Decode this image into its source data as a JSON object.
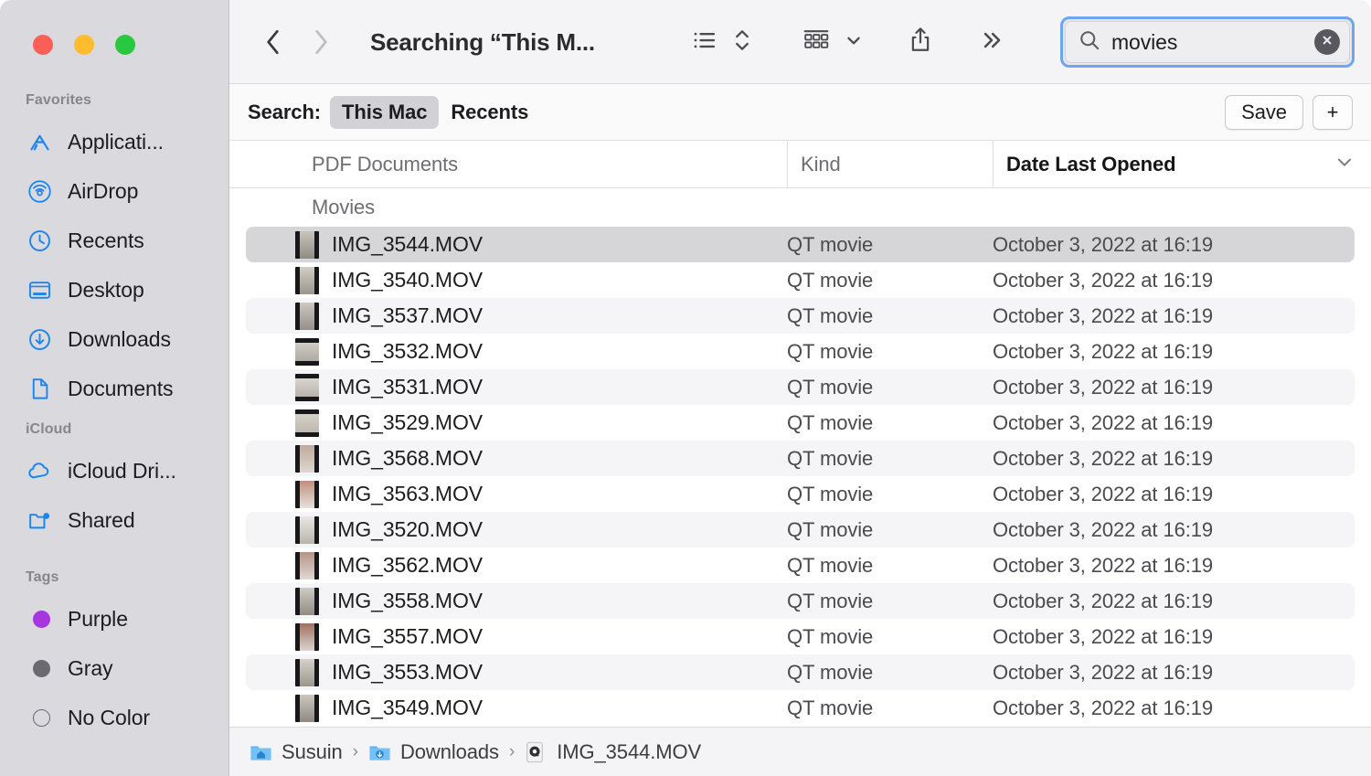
{
  "window": {
    "title": "Searching “This M...",
    "traffic_lights": [
      {
        "name": "close",
        "color": "#FC5F57"
      },
      {
        "name": "minimize",
        "color": "#FDBC2E"
      },
      {
        "name": "zoom",
        "color": "#28C840"
      }
    ]
  },
  "toolbar": {
    "back_icon": "chevron-left-icon",
    "forward_icon": "chevron-right-icon",
    "list_view_icon": "list-view-icon",
    "sort_icon": "sort-updown-icon",
    "group_icon": "group-by-icon",
    "group_chevron_icon": "chevron-down-icon",
    "share_icon": "share-icon",
    "more_icon": "double-chevron-right-icon"
  },
  "search": {
    "value": "movies",
    "placeholder": "Search",
    "search_icon": "search-icon",
    "clear_icon": "clear-circle-icon",
    "focus_color": "#6CA6F3"
  },
  "scopebar": {
    "label": "Search:",
    "scopes": [
      {
        "label": "This Mac",
        "selected": true
      },
      {
        "label": "Recents",
        "selected": false
      }
    ],
    "save_label": "Save",
    "add_label": "+"
  },
  "sidebar": {
    "sections": [
      {
        "title": "Favorites",
        "items": [
          {
            "label": "Applicati...",
            "icon": "applications-icon"
          },
          {
            "label": "AirDrop",
            "icon": "airdrop-icon"
          },
          {
            "label": "Recents",
            "icon": "clock-icon"
          },
          {
            "label": "Desktop",
            "icon": "desktop-icon"
          },
          {
            "label": "Downloads",
            "icon": "download-circle-icon"
          },
          {
            "label": "Documents",
            "icon": "document-icon"
          }
        ]
      },
      {
        "title": "iCloud",
        "items": [
          {
            "label": "iCloud Dri...",
            "icon": "cloud-icon"
          },
          {
            "label": "Shared",
            "icon": "shared-folder-icon"
          }
        ]
      },
      {
        "title": "Tags",
        "items": [
          {
            "label": "Purple",
            "icon": "tag-dot-icon",
            "color": "#A736DE"
          },
          {
            "label": "Gray",
            "icon": "tag-dot-icon",
            "color": "#6A6A70"
          },
          {
            "label": "No Color",
            "icon": "tag-dot-outline-icon",
            "color": "transparent"
          }
        ]
      }
    ]
  },
  "columns": {
    "name": "PDF Documents",
    "kind": "Kind",
    "date": "Date Last Opened",
    "sort_chevron_icon": "chevron-down-icon"
  },
  "filelist": {
    "group_label": "Movies",
    "rows": [
      {
        "name": "IMG_3544.MOV",
        "kind": "QT movie",
        "date": "October 3, 2022 at 16:19",
        "selected": true,
        "thumb": "portrait"
      },
      {
        "name": "IMG_3540.MOV",
        "kind": "QT movie",
        "date": "October 3, 2022 at 16:19",
        "selected": false,
        "thumb": "portrait"
      },
      {
        "name": "IMG_3537.MOV",
        "kind": "QT movie",
        "date": "October 3, 2022 at 16:19",
        "selected": false,
        "thumb": "portrait"
      },
      {
        "name": "IMG_3532.MOV",
        "kind": "QT movie",
        "date": "October 3, 2022 at 16:19",
        "selected": false,
        "thumb": "landscape"
      },
      {
        "name": "IMG_3531.MOV",
        "kind": "QT movie",
        "date": "October 3, 2022 at 16:19",
        "selected": false,
        "thumb": "landscape"
      },
      {
        "name": "IMG_3529.MOV",
        "kind": "QT movie",
        "date": "October 3, 2022 at 16:19",
        "selected": false,
        "thumb": "landscape"
      },
      {
        "name": "IMG_3568.MOV",
        "kind": "QT movie",
        "date": "October 3, 2022 at 16:19",
        "selected": false,
        "thumb": "portrait"
      },
      {
        "name": "IMG_3563.MOV",
        "kind": "QT movie",
        "date": "October 3, 2022 at 16:19",
        "selected": false,
        "thumb": "portrait"
      },
      {
        "name": "IMG_3520.MOV",
        "kind": "QT movie",
        "date": "October 3, 2022 at 16:19",
        "selected": false,
        "thumb": "portrait"
      },
      {
        "name": "IMG_3562.MOV",
        "kind": "QT movie",
        "date": "October 3, 2022 at 16:19",
        "selected": false,
        "thumb": "portrait"
      },
      {
        "name": "IMG_3558.MOV",
        "kind": "QT movie",
        "date": "October 3, 2022 at 16:19",
        "selected": false,
        "thumb": "portrait"
      },
      {
        "name": "IMG_3557.MOV",
        "kind": "QT movie",
        "date": "October 3, 2022 at 16:19",
        "selected": false,
        "thumb": "portrait"
      },
      {
        "name": "IMG_3553.MOV",
        "kind": "QT movie",
        "date": "October 3, 2022 at 16:19",
        "selected": false,
        "thumb": "portrait"
      },
      {
        "name": "IMG_3549.MOV",
        "kind": "QT movie",
        "date": "October 3, 2022 at 16:19",
        "selected": false,
        "thumb": "portrait"
      }
    ]
  },
  "pathbar": {
    "items": [
      {
        "label": "Susuin",
        "icon": "home-folder-icon"
      },
      {
        "label": "Downloads",
        "icon": "downloads-folder-icon"
      },
      {
        "label": "IMG_3544.MOV",
        "icon": "quicktime-icon"
      }
    ],
    "separator": "›"
  }
}
